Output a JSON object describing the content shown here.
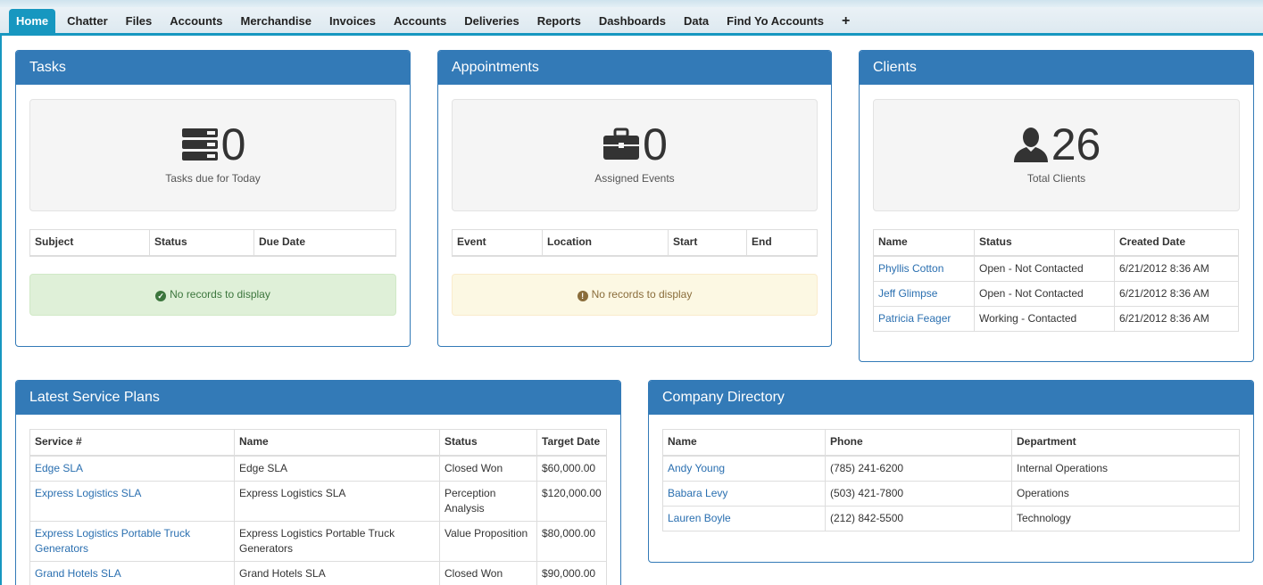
{
  "tabs": [
    "Home",
    "Chatter",
    "Files",
    "Accounts",
    "Merchandise",
    "Invoices",
    "Accounts",
    "Deliveries",
    "Reports",
    "Dashboards",
    "Data",
    "Find Yo Accounts"
  ],
  "tab_add": "+",
  "tasks": {
    "title": "Tasks",
    "count": "0",
    "caption": "Tasks due for Today",
    "columns": [
      "Subject",
      "Status",
      "Due Date"
    ],
    "empty": "No records to display"
  },
  "appointments": {
    "title": "Appointments",
    "count": "0",
    "caption": "Assigned Events",
    "columns": [
      "Event",
      "Location",
      "Start",
      "End"
    ],
    "empty": "No records to display"
  },
  "clients": {
    "title": "Clients",
    "count": "26",
    "caption": "Total Clients",
    "columns": [
      "Name",
      "Status",
      "Created Date"
    ],
    "rows": [
      [
        "Phyllis Cotton",
        "Open - Not Contacted",
        "6/21/2012 8:36 AM"
      ],
      [
        "Jeff Glimpse",
        "Open - Not Contacted",
        "6/21/2012 8:36 AM"
      ],
      [
        "Patricia Feager",
        "Working - Contacted",
        "6/21/2012 8:36 AM"
      ]
    ]
  },
  "service_plans": {
    "title": "Latest Service Plans",
    "columns": [
      "Service #",
      "Name",
      "Status",
      "Target Date"
    ],
    "rows": [
      [
        "Edge SLA",
        "Edge SLA",
        "Closed Won",
        "$60,000.00"
      ],
      [
        "Express Logistics SLA",
        "Express Logistics SLA",
        "Perception Analysis",
        "$120,000.00"
      ],
      [
        "Express Logistics Portable Truck Generators",
        "Express Logistics Portable Truck Generators",
        "Value Proposition",
        "$80,000.00"
      ],
      [
        "Grand Hotels SLA",
        "Grand Hotels SLA",
        "Closed Won",
        "$90,000.00"
      ]
    ]
  },
  "directory": {
    "title": "Company Directory",
    "columns": [
      "Name",
      "Phone",
      "Department"
    ],
    "rows": [
      [
        "Andy Young",
        "(785) 241-6200",
        "Internal Operations"
      ],
      [
        "Babara Levy",
        "(503) 421-7800",
        "Operations"
      ],
      [
        "Lauren Boyle",
        "(212) 842-5500",
        "Technology"
      ]
    ]
  },
  "icons": {
    "tasks": "tasks-icon",
    "appointments": "briefcase-icon",
    "clients": "user-icon",
    "success": "check-circle-icon",
    "warning": "exclamation-circle-icon"
  },
  "colors": {
    "accent": "#1797c0",
    "panel": "#337ab7",
    "link": "#2a6fb0"
  }
}
